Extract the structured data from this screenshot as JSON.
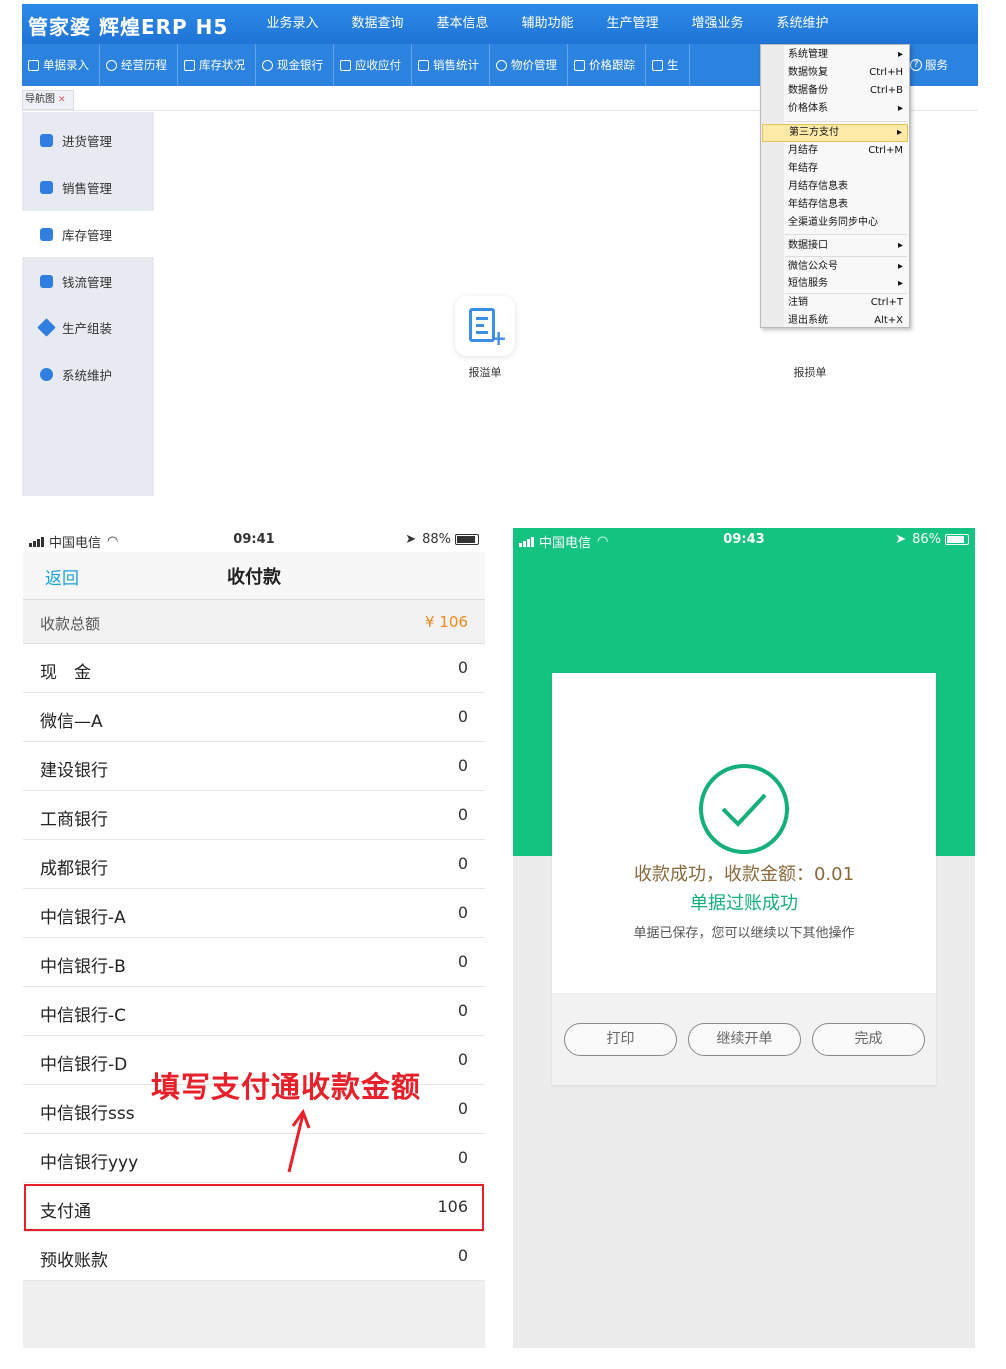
{
  "erp": {
    "logo": "管家婆 辉煌ERP H5",
    "menu": [
      "业务录入",
      "数据查询",
      "基本信息",
      "辅助功能",
      "生产管理",
      "增强业务",
      "系统维护"
    ],
    "tools": [
      "单据录入",
      "经营历程",
      "库存状况",
      "现金银行",
      "应收应付",
      "销售统计",
      "物价管理",
      "价格跟踪",
      "生"
    ],
    "service": "服务",
    "nav_tab": "导航图",
    "sidebar": [
      "进货管理",
      "销售管理",
      "库存管理",
      "钱流管理",
      "生产组装",
      "系统维护"
    ],
    "active_sidebar": 2,
    "tiles": [
      "报溢单",
      "报损单"
    ],
    "context_menu": [
      {
        "label": "系统管理",
        "shortcut": "▸"
      },
      {
        "label": "数据恢复",
        "shortcut": "Ctrl+H"
      },
      {
        "label": "数据备份",
        "shortcut": "Ctrl+B"
      },
      {
        "label": "价格体系",
        "shortcut": "▸"
      },
      {
        "label": "第三方支付",
        "shortcut": "▸"
      },
      {
        "label": "月结存",
        "shortcut": "Ctrl+M"
      },
      {
        "label": "年结存",
        "shortcut": ""
      },
      {
        "label": "月结存信息表",
        "shortcut": ""
      },
      {
        "label": "年结存信息表",
        "shortcut": ""
      },
      {
        "label": "全渠道业务同步中心",
        "shortcut": ""
      },
      {
        "label": "数据接口",
        "shortcut": "▸"
      },
      {
        "label": "微信公众号",
        "shortcut": "▸"
      },
      {
        "label": "短信服务",
        "shortcut": "▸"
      },
      {
        "label": "注销",
        "shortcut": "Ctrl+T"
      },
      {
        "label": "退出系统",
        "shortcut": "Alt+X"
      }
    ]
  },
  "phone1": {
    "carrier": "中国电信",
    "time": "09:41",
    "battery": "88%",
    "back": "返回",
    "title": "收付款",
    "total_label": "收款总额",
    "total_value": "¥ 106",
    "rows": [
      {
        "label": "现　金",
        "value": "0"
      },
      {
        "label": "微信—A",
        "value": "0"
      },
      {
        "label": "建设银行",
        "value": "0"
      },
      {
        "label": "工商银行",
        "value": "0"
      },
      {
        "label": "成都银行",
        "value": "0"
      },
      {
        "label": "中信银行-A",
        "value": "0"
      },
      {
        "label": "中信银行-B",
        "value": "0"
      },
      {
        "label": "中信银行-C",
        "value": "0"
      },
      {
        "label": "中信银行-D",
        "value": "0"
      },
      {
        "label": "中信银行sss",
        "value": "0"
      },
      {
        "label": "中信银行yyy",
        "value": "0"
      },
      {
        "label": "支付通",
        "value": "106"
      },
      {
        "label": "预收账款",
        "value": "0"
      }
    ],
    "annotation": "填写支付通收款金额"
  },
  "phone2": {
    "carrier": "中国电信",
    "time": "09:43",
    "battery": "86%",
    "msg_amount": "收款成功，收款金额：0.01",
    "msg_posted": "单据过账成功",
    "msg_hint": "单据已保存，您可以继续以下其他操作",
    "buttons": [
      "打印",
      "继续开单",
      "完成"
    ]
  },
  "colors": {
    "erp_blue": "#2d8ae8",
    "success_green": "#13c37f",
    "highlight_red": "#e8202a",
    "amount_orange": "#f08a1a"
  }
}
